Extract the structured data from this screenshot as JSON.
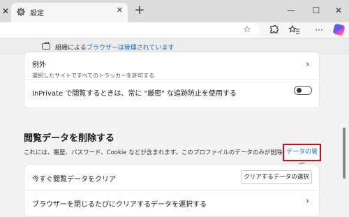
{
  "tab": {
    "title": "設定",
    "close": "✕"
  },
  "left_close": "✕",
  "newtab": "+",
  "window": {
    "minimize": "—",
    "maximize": "☐",
    "close": "✕"
  },
  "managed": {
    "prefix": "組織による",
    "link": "ブラウザーは管理されています"
  },
  "exceptions": {
    "title": "例外",
    "subtitle": "選択したサイトですべてのトラッカーを許可する"
  },
  "inprivate": {
    "label": "InPrivate で閲覧するときは、常に \"厳密\" な追跡防止を使用する",
    "toggle_on": false
  },
  "browsing_data": {
    "section_title": "閲覧データを削除する",
    "description": "これには、履歴、パスワード、Cookie などが含まれます。このプロファイルのデータのみが削除されます。",
    "manage_link": "データの管理",
    "clear_now_label": "今すぐ閲覧データをクリア",
    "choose_button": "クリアするデータの選択",
    "on_close_label": "ブラウザーを閉じるたびにクリアするデータを選択する"
  },
  "colors": {
    "accent": "#0f6cbd",
    "highlight": "#e60012"
  }
}
